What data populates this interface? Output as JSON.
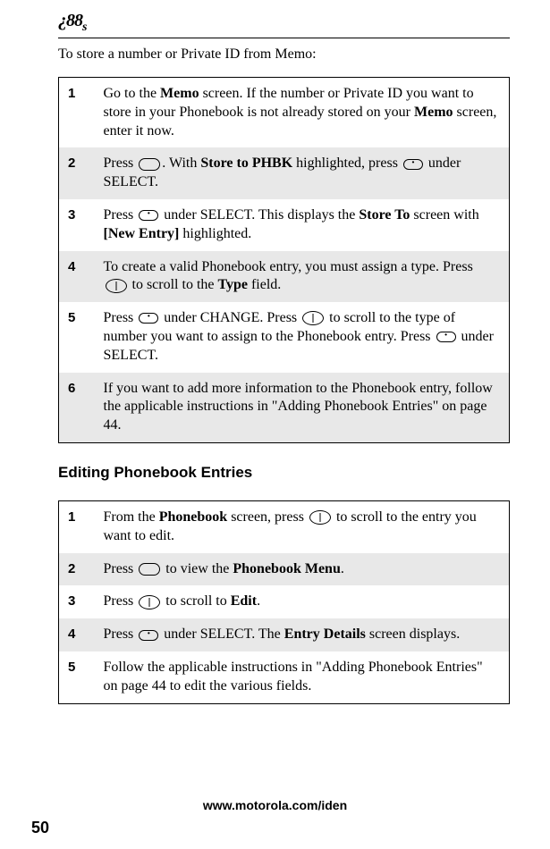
{
  "header": {
    "logo": "¿88",
    "logo_sub": "s"
  },
  "intro": "To store a number or Private ID from Memo:",
  "table1": {
    "rows": [
      {
        "num": "1",
        "text_parts": [
          "Go to the ",
          "Memo",
          " screen. If the number or Private ID you want to store in your Phonebook is not already stored on your ",
          "Memo",
          " screen, enter it now."
        ]
      },
      {
        "num": "2",
        "text_parts": [
          "Press ",
          "MENU_ICON",
          ". With ",
          "Store to PHBK",
          " highlighted, press ",
          "BUTTON_ICON",
          " under SELECT."
        ]
      },
      {
        "num": "3",
        "text_parts": [
          "Press ",
          "BUTTON_ICON",
          " under SELECT. This displays the ",
          "Store To",
          " screen with ",
          "[New Entry]",
          " highlighted."
        ]
      },
      {
        "num": "4",
        "text_parts": [
          "To create a valid Phonebook entry, you must assign a type. Press ",
          "SCROLL_ICON",
          " to scroll to the ",
          "Type",
          " field."
        ]
      },
      {
        "num": "5",
        "text_parts": [
          "Press ",
          "BUTTON_ICON",
          " under CHANGE. Press ",
          "SCROLL_ICON",
          " to scroll to the type of number you want to assign to the Phonebook entry. Press ",
          "BUTTON_ICON",
          " under SELECT."
        ]
      },
      {
        "num": "6",
        "text_parts": [
          "If you want to add more information to the Phonebook entry, follow the applicable instructions in \"Adding Phonebook Entries\" on page 44."
        ]
      }
    ]
  },
  "section_heading": "Editing Phonebook Entries",
  "table2": {
    "rows": [
      {
        "num": "1",
        "text_parts": [
          "From the ",
          "Phonebook",
          " screen, press ",
          "SCROLL_ICON",
          " to scroll to the entry you want to edit."
        ]
      },
      {
        "num": "2",
        "text_parts": [
          "Press ",
          "MENU_ICON",
          " to view the ",
          "Phonebook Menu",
          "."
        ]
      },
      {
        "num": "3",
        "text_parts": [
          "Press ",
          "SCROLL_ICON",
          " to scroll to ",
          "Edit",
          "."
        ]
      },
      {
        "num": "4",
        "text_parts": [
          "Press ",
          "BUTTON_ICON",
          " under SELECT. The ",
          "Entry Details",
          " screen displays."
        ]
      },
      {
        "num": "5",
        "text_parts": [
          "Follow the applicable instructions in \"Adding Phonebook Entries\" on page 44 to edit the various fields."
        ]
      }
    ]
  },
  "bold_terms": [
    "Memo",
    "Store to PHBK",
    "Store To",
    "[New Entry]",
    "Type",
    "Phonebook",
    "Phonebook Menu",
    "Edit",
    "Entry Details"
  ],
  "footer": {
    "url": "www.motorola.com/iden",
    "page": "50"
  }
}
